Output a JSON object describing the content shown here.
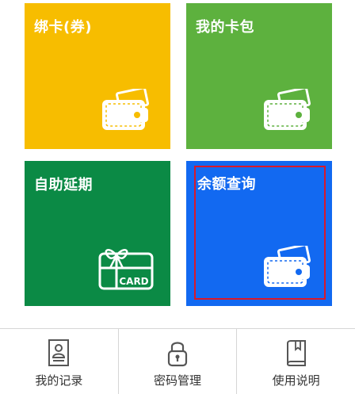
{
  "tiles": {
    "bind": {
      "title": "绑卡(券)",
      "color": "#f7bd00",
      "icon": "wallet-icon"
    },
    "wallet": {
      "title": "我的卡包",
      "color": "#5db13e",
      "icon": "wallet-icon"
    },
    "extend": {
      "title": "自助延期",
      "color": "#0b8a45",
      "icon": "gift-card-icon",
      "icon_text": "CARD"
    },
    "balance": {
      "title": "余额查询",
      "color": "#1269f1",
      "icon": "wallet-icon",
      "highlight_color": "#d8192a"
    }
  },
  "bottom_nav": {
    "items": [
      {
        "label": "我的记录",
        "icon": "id-card-icon"
      },
      {
        "label": "密码管理",
        "icon": "lock-icon"
      },
      {
        "label": "使用说明",
        "icon": "book-icon"
      }
    ]
  }
}
